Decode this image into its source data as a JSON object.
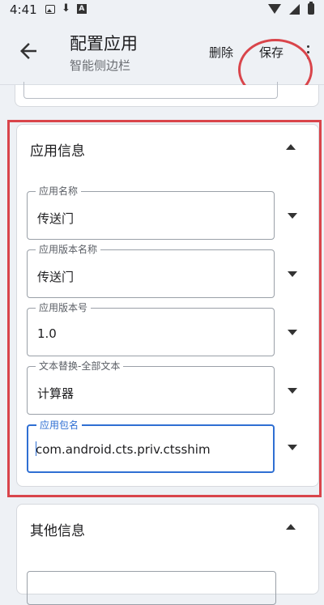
{
  "status_bar": {
    "time": "4:41"
  },
  "app_bar": {
    "title": "配置应用",
    "subtitle": "智能侧边栏",
    "delete_label": "删除",
    "save_label": "保存"
  },
  "app_info": {
    "title": "应用信息",
    "fields": [
      {
        "label": "应用名称",
        "value": "传送门"
      },
      {
        "label": "应用版本名称",
        "value": "传送门"
      },
      {
        "label": "应用版本号",
        "value": "1.0"
      },
      {
        "label": "文本替换-全部文本",
        "value": "计算器"
      },
      {
        "label": "应用包名",
        "value": "com.android.cts.priv.ctsshim"
      }
    ]
  },
  "other_info": {
    "title": "其他信息"
  },
  "colors": {
    "highlight": "#d9454b",
    "focus": "#2f6fd3"
  }
}
